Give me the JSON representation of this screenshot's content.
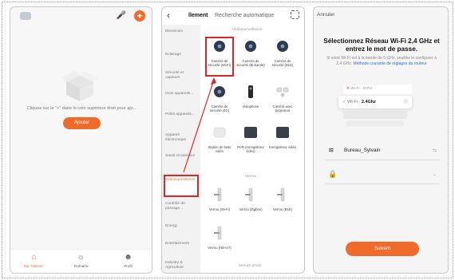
{
  "colors": {
    "accent": "#f06a2a",
    "highlight": "#e0252a",
    "link": "#2f6fd6"
  },
  "phone1": {
    "hint": "Cliquez sur le \"+\" dans le coin supérieur droit pour ajo...",
    "add_button": "Ajouter",
    "tabs": [
      {
        "label": "Ma \"Maison\"",
        "icon": "home-icon"
      },
      {
        "label": "Scénario",
        "icon": "sun-icon"
      },
      {
        "label": "Profil",
        "icon": "user-icon"
      }
    ]
  },
  "phone2": {
    "tab_manual": "llement",
    "tab_auto": "Recherche automatique",
    "categories": [
      "Electricien",
      "Éclairage",
      "Sécurité et capteurs",
      "Gros appareils...",
      "Petits appareils...",
      "Appareil électronique",
      "Santé et exercice",
      "Vidéosurveillance",
      "Contrôle de passage...",
      "Energy",
      "Entertainment",
      "Industry & Agriculture"
    ],
    "section_video": "Vidéosurveillance",
    "section_lock": "Verrou",
    "section_bottom": "serrure photo",
    "devices": [
      "Caméra de sécurité (Wi-Fi)",
      "Caméra de sécurité (Bi-bande)",
      "Caméra de sécurité (BLE)",
      "Caméra de sécurité (4G)",
      "Visiophone",
      "Caméra avec projecteur",
      "Station de base vidéo",
      "NVR (enregistreur vidéo)",
      "Enregistreur vidéo"
    ],
    "locks": [
      "Verrou (Wi-Fi)",
      "Verrou (Zigbee)",
      "Verrou (BLE)",
      "Verrou (NB-IoT)"
    ]
  },
  "phone3": {
    "cancel": "Annuler",
    "title": "Sélectionnez Réseau Wi-Fi 2,4 GHz et entrez le mot de passe.",
    "subtitle": "Si votre Wi-Fi est à la bande de 5 GHz, veuillez le configurer à 2,4 GHz.",
    "link": "Méthode courante de réglages du routeur",
    "wifi_5g": "Wi-Fi - 5Ghz",
    "wifi_24_prefix": "Wi-Fi - ",
    "wifi_24_band": "2.4Ghz",
    "network_name": "Bureau_Sylvain",
    "next_button": "Suivant"
  }
}
